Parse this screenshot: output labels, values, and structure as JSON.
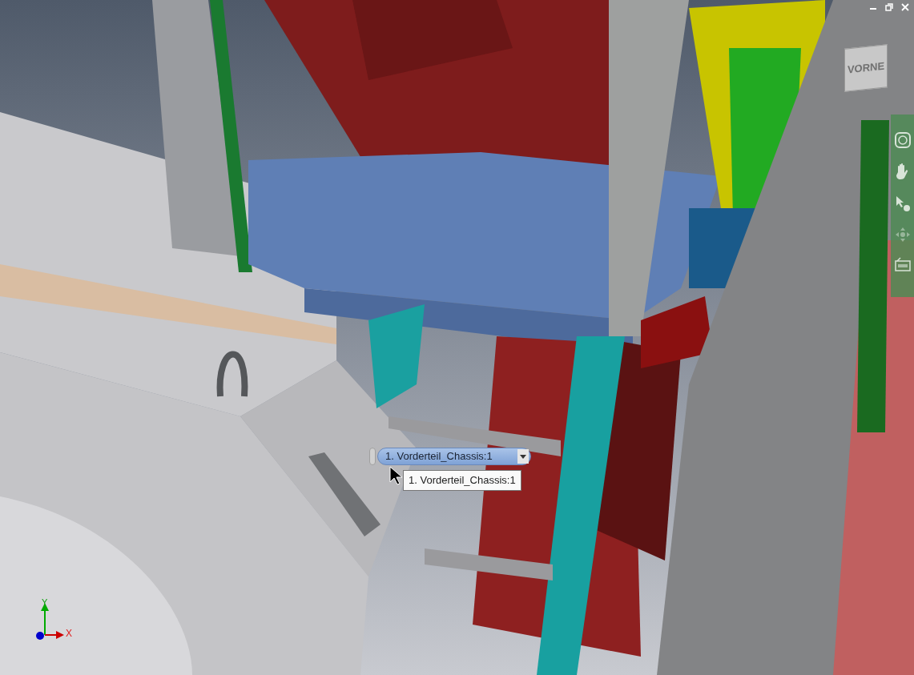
{
  "window_controls": [
    {
      "kind": "minimize"
    },
    {
      "kind": "restore"
    },
    {
      "kind": "close"
    }
  ],
  "view_cube": {
    "face": "VORNE"
  },
  "navigation_bar": {
    "tools": [
      {
        "kind": "steering"
      },
      {
        "kind": "pan"
      },
      {
        "kind": "select"
      },
      {
        "kind": "orbit"
      },
      {
        "kind": "view"
      }
    ]
  },
  "selection": {
    "value": "1. Vorderteil_Chassis:1",
    "tooltip": "1. Vorderteil_Chassis:1"
  },
  "axis_triad": {
    "y_label": "Y",
    "x_label": "X"
  }
}
